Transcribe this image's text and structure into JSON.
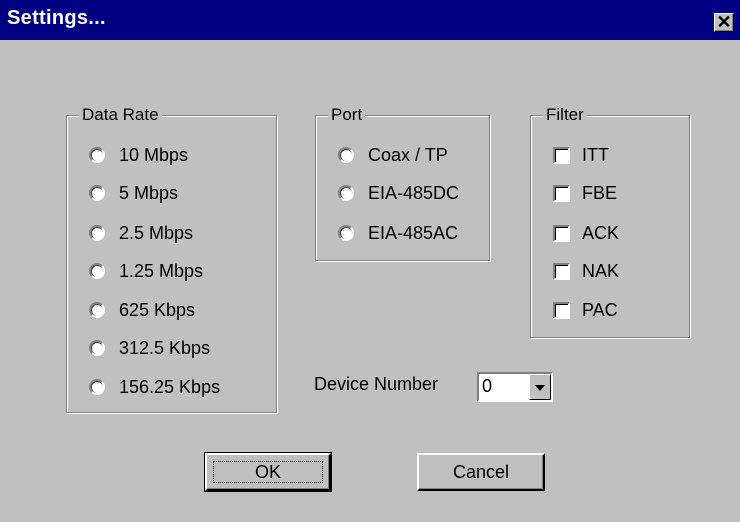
{
  "window": {
    "title": "Settings...",
    "close_glyph": "✕"
  },
  "data_rate": {
    "legend": "Data Rate",
    "options": [
      "10 Mbps",
      "5 Mbps",
      "2.5 Mbps",
      "1.25 Mbps",
      "625 Kbps",
      "312.5 Kbps",
      "156.25 Kbps"
    ]
  },
  "port": {
    "legend": "Port",
    "options": [
      "Coax / TP",
      "EIA-485DC",
      "EIA-485AC"
    ]
  },
  "filter": {
    "legend": "Filter",
    "options": [
      "ITT",
      "FBE",
      "ACK",
      "NAK",
      "PAC"
    ]
  },
  "device_number": {
    "label": "Device Number",
    "value": "0"
  },
  "buttons": {
    "ok": "OK",
    "cancel": "Cancel"
  }
}
